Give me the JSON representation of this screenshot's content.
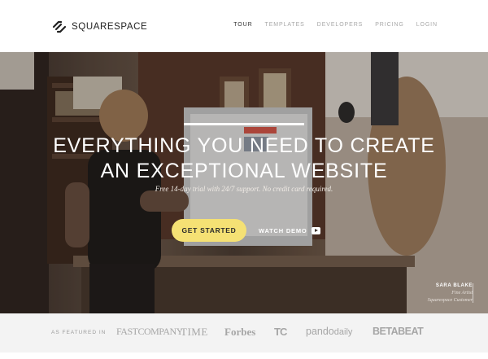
{
  "header": {
    "brand": "SQUARESPACE",
    "nav": [
      {
        "label": "TOUR",
        "active": true
      },
      {
        "label": "TEMPLATES",
        "active": false
      },
      {
        "label": "DEVELOPERS",
        "active": false
      },
      {
        "label": "PRICING",
        "active": false
      },
      {
        "label": "LOGIN",
        "active": false
      }
    ]
  },
  "hero": {
    "title_line1": "EVERYTHING YOU NEED TO CREATE",
    "title_line2": "AN EXCEPTIONAL WEBSITE",
    "subtitle": "Free 14-day trial with 24/7 support. No credit card required.",
    "cta_label": "GET STARTED",
    "demo_label": "WATCH DEMO",
    "credit": {
      "name": "SARA BLAKE",
      "role": "Fine Artist",
      "customer": "Squarespace Customer"
    }
  },
  "featured": {
    "label": "AS FEATURED IN",
    "press": {
      "fastco": "FASTCOMPANY",
      "time": "TIME",
      "forbes": "Forbes",
      "tc": "TC",
      "pando_main": "pando",
      "pando_daily": "daily",
      "beta": "BETABEAT"
    }
  },
  "colors": {
    "accent": "#f5e174",
    "text_dark": "#222222",
    "nav_muted": "#a8a8a8",
    "featured_bg": "#f3f3f3",
    "press_gray": "#a6a6a6"
  },
  "icons": {
    "logo": "squarespace-logo-icon",
    "play": "play-icon"
  }
}
